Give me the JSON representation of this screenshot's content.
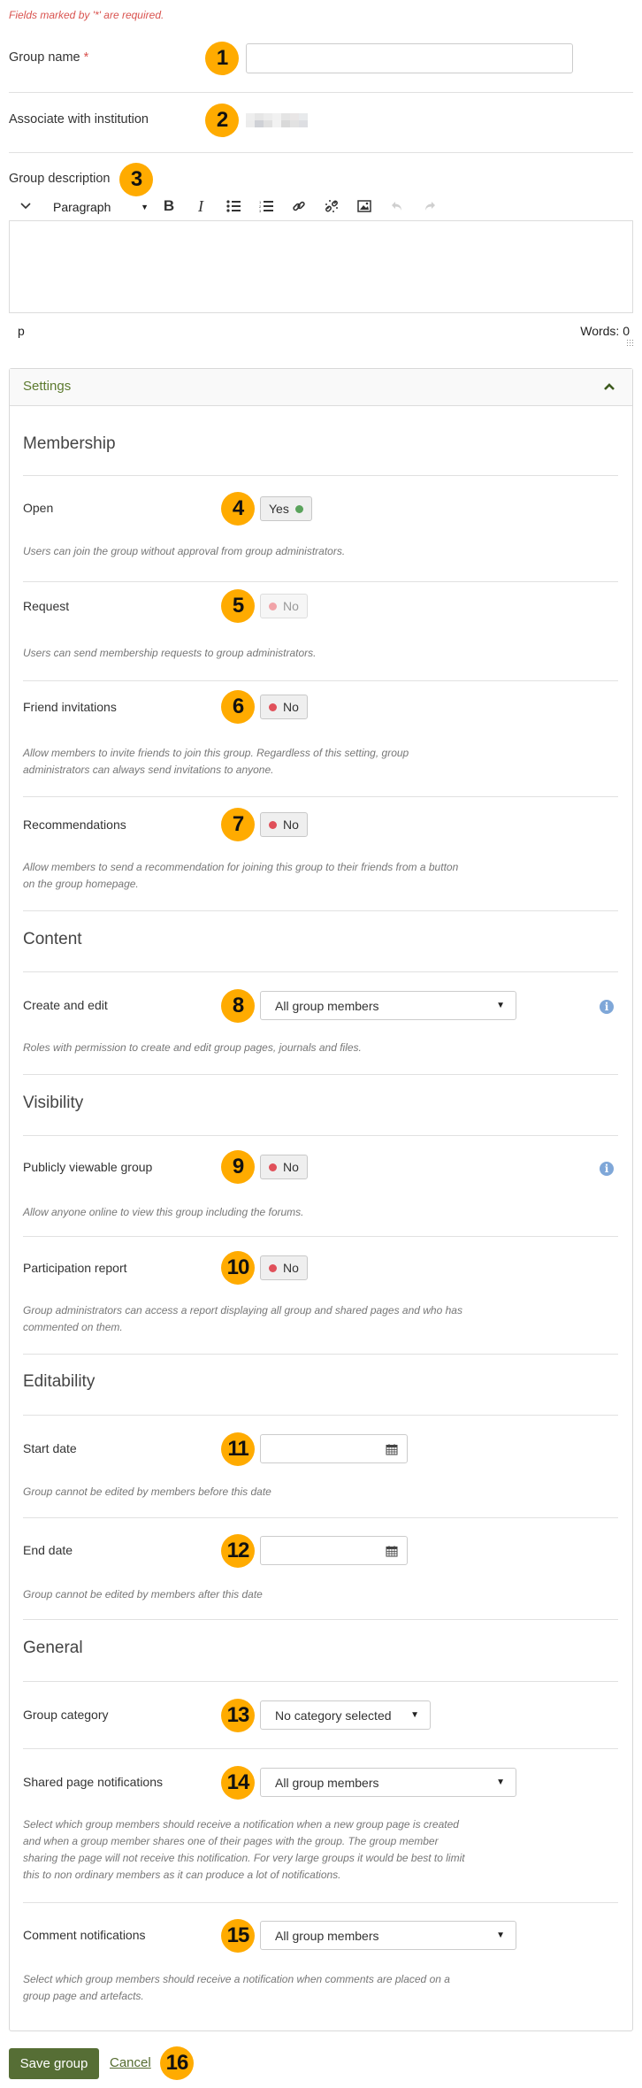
{
  "form": {
    "required_note": "Fields marked by '*' are required.",
    "group_name": {
      "label": "Group name",
      "required_marker": "*",
      "value": "",
      "badge": "1"
    },
    "institution": {
      "label": "Associate with institution",
      "badge": "2",
      "value_redacted": true
    },
    "description": {
      "label": "Group description",
      "badge": "3",
      "toolbar": {
        "toggle_icon": "chevron-down-icon",
        "format_select": "Paragraph",
        "buttons": [
          {
            "name": "bold",
            "glyph": "B"
          },
          {
            "name": "italic",
            "glyph": "I"
          },
          {
            "name": "bullet-list",
            "glyph": "≔"
          },
          {
            "name": "numbered-list",
            "glyph": "≔"
          },
          {
            "name": "link",
            "glyph": "🔗"
          },
          {
            "name": "unlink",
            "glyph": "⛓"
          },
          {
            "name": "image",
            "glyph": "▣"
          },
          {
            "name": "undo",
            "glyph": "↶",
            "disabled": true
          },
          {
            "name": "redo",
            "glyph": "↷",
            "disabled": true
          }
        ]
      },
      "content": "",
      "status_path": "p",
      "word_count": "Words: 0"
    }
  },
  "settings": {
    "title": "Settings",
    "expanded": true,
    "sections": {
      "membership": {
        "title": "Membership",
        "open": {
          "label": "Open",
          "badge": "4",
          "value": "Yes",
          "state": "on",
          "desc": "Users can join the group without approval from group administrators."
        },
        "request": {
          "label": "Request",
          "badge": "5",
          "value": "No",
          "state": "off-disabled",
          "desc": "Users can send membership requests to group administrators."
        },
        "friend_invitations": {
          "label": "Friend invitations",
          "badge": "6",
          "value": "No",
          "state": "off",
          "desc_line1": "Allow members to invite friends to join this group. Regardless of this setting, group",
          "desc_line2": "administrators can always send invitations to anyone."
        },
        "recommendations": {
          "label": "Recommendations",
          "badge": "7",
          "value": "No",
          "state": "off",
          "desc_line1": "Allow members to send a recommendation for joining this group to their friends from a button",
          "desc_line2": "on the group homepage."
        }
      },
      "content": {
        "title": "Content",
        "create_and_edit": {
          "label": "Create and edit",
          "badge": "8",
          "selected": "All group members",
          "desc": "Roles with permission to create and edit group pages, journals and files."
        }
      },
      "visibility": {
        "title": "Visibility",
        "publicly_viewable": {
          "label": "Publicly viewable group",
          "badge": "9",
          "value": "No",
          "state": "off",
          "desc": "Allow anyone online to view this group including the forums."
        },
        "participation_report": {
          "label": "Participation report",
          "badge": "10",
          "value": "No",
          "state": "off",
          "desc_line1": "Group administrators can access a report displaying all group and shared pages and who has",
          "desc_line2": "commented on them."
        }
      },
      "editability": {
        "title": "Editability",
        "start_date": {
          "label": "Start date",
          "badge": "11",
          "value": "",
          "desc": "Group cannot be edited by members before this date"
        },
        "end_date": {
          "label": "End date",
          "badge": "12",
          "value": "",
          "desc": "Group cannot be edited by members after this date"
        }
      },
      "general": {
        "title": "General",
        "group_category": {
          "label": "Group category",
          "badge": "13",
          "selected": "No category selected"
        },
        "shared_page_notifications": {
          "label": "Shared page notifications",
          "badge": "14",
          "selected": "All group members",
          "desc_line1": "Select which group members should receive a notification when a new group page is created",
          "desc_line2": "and when a group member shares one of their pages with the group. The group member",
          "desc_line3": "sharing the page will not receive this notification. For very large groups it would be best to limit",
          "desc_line4": "this to non ordinary members as it can produce a lot of notifications."
        },
        "comment_notifications": {
          "label": "Comment notifications",
          "badge": "15",
          "selected": "All group members",
          "desc_line1": "Select which group members should receive a notification when comments are placed on a",
          "desc_line2": "group page and artefacts."
        }
      }
    }
  },
  "actions": {
    "save_label": "Save group",
    "cancel_label": "Cancel",
    "badge": "16"
  },
  "colors": {
    "badge": "#ffab00",
    "accent_green": "#566e35",
    "required_red": "#d9534f",
    "on_dot": "#5aa35c",
    "off_dot": "#e0505a",
    "info_blue": "#7fa7d8"
  }
}
